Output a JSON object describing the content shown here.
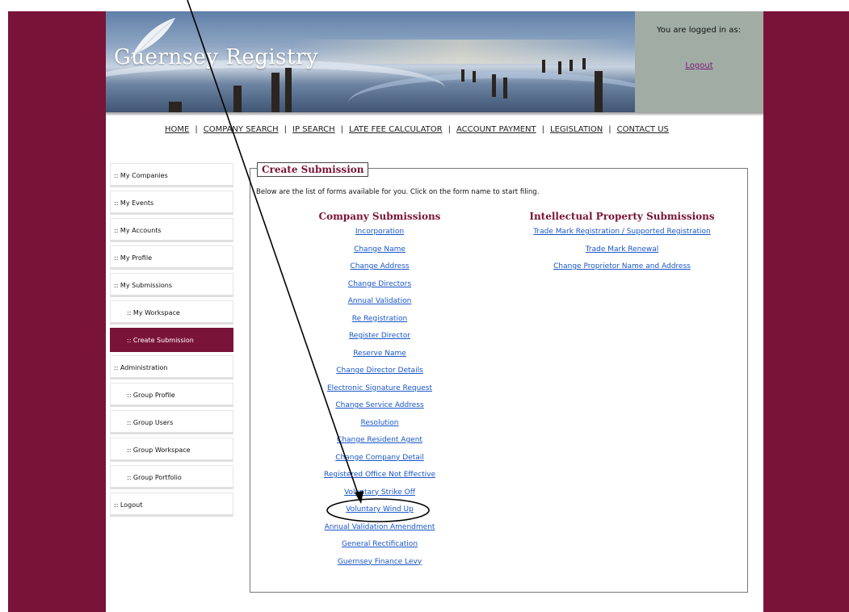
{
  "header": {
    "logo_text": "Guernsey Registry",
    "login_label": "You are logged in as:",
    "logout_label": "Logout"
  },
  "topnav": {
    "items": [
      "HOME",
      "COMPANY SEARCH",
      "IP SEARCH",
      "LATE FEE CALCULATOR",
      "ACCOUNT PAYMENT",
      "LEGISLATION",
      "CONTACT US"
    ],
    "separator": "|"
  },
  "sidebar": {
    "items": [
      {
        "label": ":: My Companies"
      },
      {
        "label": ":: My Events"
      },
      {
        "label": ":: My Accounts"
      },
      {
        "label": ":: My Profile"
      },
      {
        "label": ":: My Submissions"
      },
      {
        "label": ":: My Workspace"
      },
      {
        "label": ":: Create Submission"
      },
      {
        "label": ":: Administration"
      },
      {
        "label": ":: Group Profile"
      },
      {
        "label": ":: Group Users"
      },
      {
        "label": ":: Group Workspace"
      },
      {
        "label": ":: Group Portfolio"
      },
      {
        "label": ":: Logout"
      }
    ]
  },
  "panel": {
    "title": "Create Submission",
    "intro": "Below are the list of forms available for you. Click on the form name to start filing.",
    "company": {
      "title": "Company Submissions",
      "links": [
        "Incorporation",
        "Change Name",
        "Change Address",
        "Change Directors",
        "Annual Validation",
        "Re Registration",
        "Register Director",
        "Reserve Name",
        "Change Director Details",
        "Electronic Signature Request",
        "Change Service Address",
        "Resolution",
        "Change Resident Agent",
        "Change Company Detail",
        "Registered Office Not Effective",
        "Voluntary Strike Off",
        "Voluntary Wind Up",
        "Annual Validation Amendment",
        "General Rectification",
        "Guernsey Finance Levy"
      ]
    },
    "ip": {
      "title": "Intellectual Property Submissions",
      "links": [
        "Trade Mark Registration / Supported Registration",
        "Trade Mark Renewal",
        "Change Proprietor Name and Address"
      ]
    }
  },
  "colors": {
    "maroon": "#7a1338",
    "login_box": "#a1ada4",
    "link_blue": "#1a56c8"
  }
}
